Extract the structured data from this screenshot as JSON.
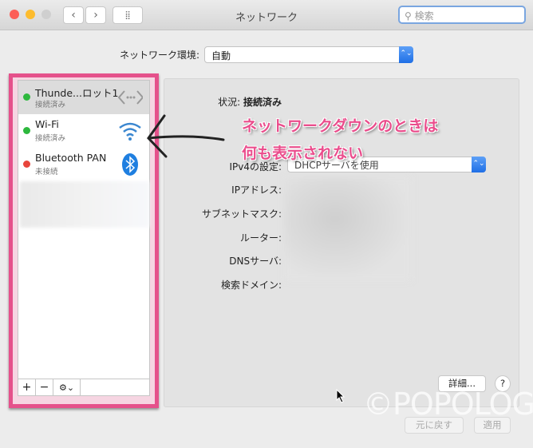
{
  "window": {
    "title": "ネットワーク",
    "search_placeholder": "検索"
  },
  "location": {
    "label": "ネットワーク環境:",
    "value": "自動"
  },
  "services": [
    {
      "name": "Thunde...ロット1",
      "status": "接続済み",
      "status_color": "#2db83d",
      "icon": "thunderbolt-bridge-icon",
      "selected": true
    },
    {
      "name": "Wi-Fi",
      "status": "接続済み",
      "status_color": "#2db83d",
      "icon": "wifi-icon"
    },
    {
      "name": "Bluetooth PAN",
      "status": "未接続",
      "status_color": "#e8453c",
      "icon": "bluetooth-icon"
    }
  ],
  "list_controls": {
    "add": "+",
    "remove": "−",
    "gear": "⚙︎⌄"
  },
  "detail": {
    "status_label": "状況:",
    "status_value": "接続済み",
    "ipv4_label": "IPv4の設定:",
    "ipv4_value": "DHCPサーバを使用",
    "ip_label": "IPアドレス:",
    "subnet_label": "サブネットマスク:",
    "router_label": "ルーター:",
    "dns_label": "DNSサーバ:",
    "search_domain_label": "検索ドメイン:"
  },
  "annotation": {
    "line1": "ネットワークダウンのときは",
    "line2": "何も表示されない",
    "color": "#ea4d8c"
  },
  "buttons": {
    "advanced": "詳細...",
    "help": "?",
    "revert": "元に戻す",
    "apply": "適用"
  },
  "watermark": "©POPOLOG"
}
